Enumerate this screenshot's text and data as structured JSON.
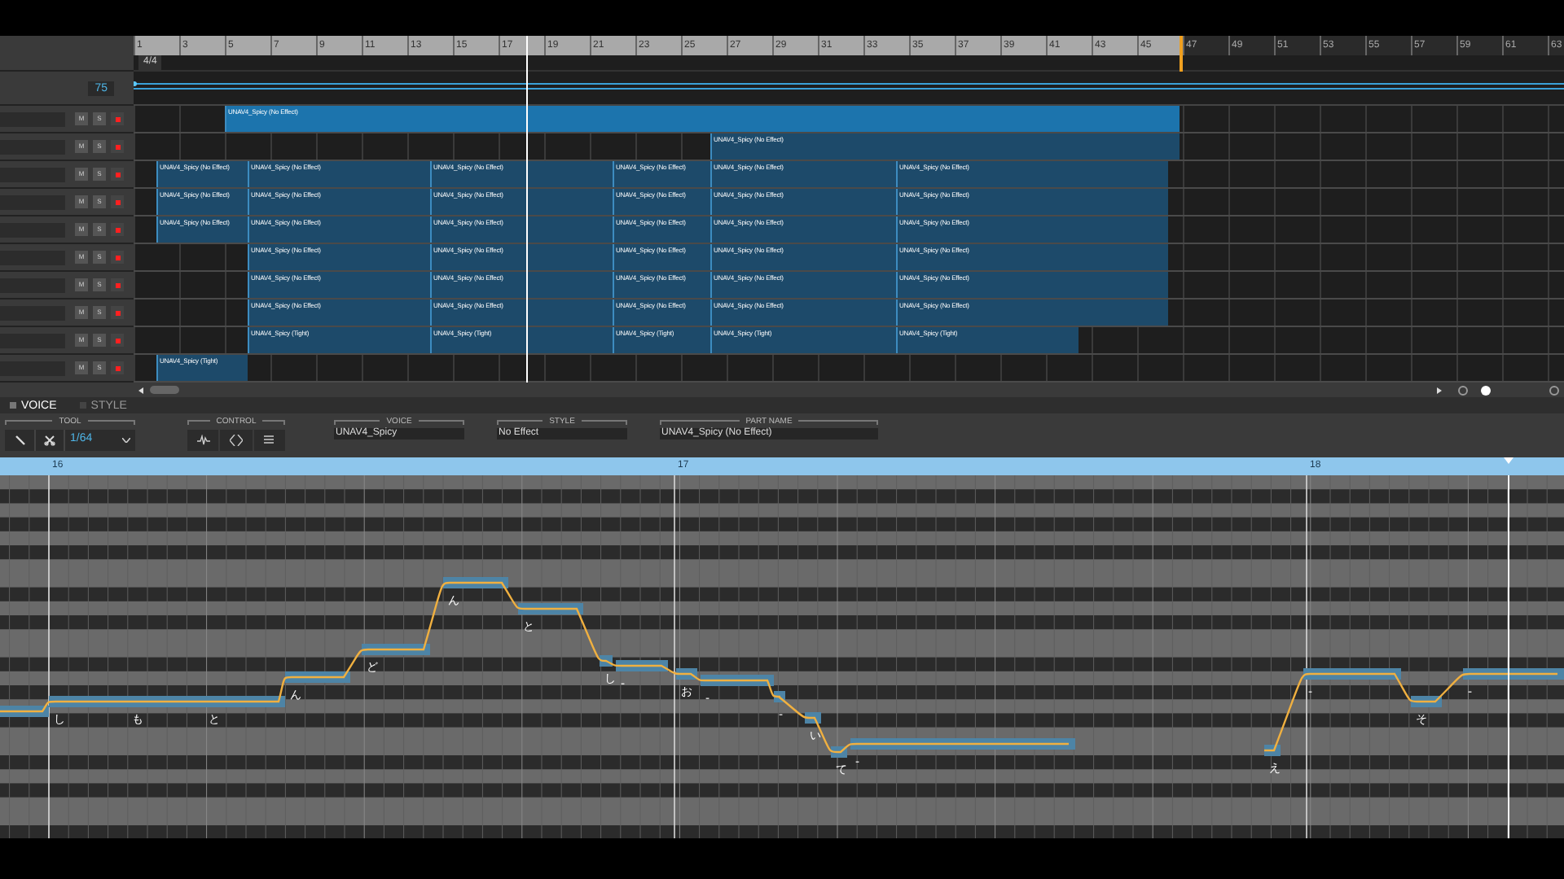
{
  "ruler": {
    "bars": [
      "1",
      "3",
      "5",
      "7",
      "9",
      "11",
      "13",
      "15",
      "17",
      "19",
      "21",
      "23",
      "25",
      "27",
      "29",
      "31",
      "33",
      "35",
      "37",
      "39",
      "41",
      "43",
      "45",
      "47",
      "49",
      "51",
      "53",
      "55",
      "57",
      "59",
      "61",
      "63"
    ]
  },
  "time_signature": "4/4",
  "tempo": "75",
  "tracks": [
    {
      "mute": "M",
      "solo": "S",
      "parts": [
        "UNAV4_Spicy (No Effect)"
      ]
    },
    {
      "mute": "M",
      "solo": "S",
      "parts": [
        "UNAV4_Spicy (No Effect)"
      ]
    },
    {
      "mute": "M",
      "solo": "S",
      "parts": [
        "UNAV4_Spicy (No Effect)",
        "UNAV4_Spicy (No Effect)",
        "UNAV4_Spicy (No Effect)",
        "UNAV4_Spicy (No Effect)",
        "UNAV4_Spicy (No Effect)",
        "UNAV4_Spicy (No Effect)"
      ]
    },
    {
      "mute": "M",
      "solo": "S",
      "parts": [
        "UNAV4_Spicy (No Effect)",
        "UNAV4_Spicy (No Effect)",
        "UNAV4_Spicy (No Effect)",
        "UNAV4_Spicy (No Effect)",
        "UNAV4_Spicy (No Effect)",
        "UNAV4_Spicy (No Effect)"
      ]
    },
    {
      "mute": "M",
      "solo": "S",
      "parts": [
        "UNAV4_Spicy (No Effect)",
        "UNAV4_Spicy (No Effect)",
        "UNAV4_Spicy (No Effect)",
        "UNAV4_Spicy (No Effect)",
        "UNAV4_Spicy (No Effect)",
        "UNAV4_Spicy (No Effect)"
      ]
    },
    {
      "mute": "M",
      "solo": "S",
      "parts": [
        "UNAV4_Spicy (No Effect)",
        "UNAV4_Spicy (No Effect)",
        "UNAV4_Spicy (No Effect)",
        "UNAV4_Spicy (No Effect)",
        "UNAV4_Spicy (No Effect)"
      ]
    },
    {
      "mute": "M",
      "solo": "S",
      "parts": [
        "UNAV4_Spicy (No Effect)",
        "UNAV4_Spicy (No Effect)",
        "UNAV4_Spicy (No Effect)",
        "UNAV4_Spicy (No Effect)",
        "UNAV4_Spicy (No Effect)"
      ]
    },
    {
      "mute": "M",
      "solo": "S",
      "parts": [
        "UNAV4_Spicy (No Effect)",
        "UNAV4_Spicy (No Effect)",
        "UNAV4_Spicy (No Effect)",
        "UNAV4_Spicy (No Effect)",
        "UNAV4_Spicy (No Effect)"
      ]
    },
    {
      "mute": "M",
      "solo": "S",
      "parts": [
        "UNAV4_Spicy (Tight)",
        "UNAV4_Spicy (Tight)",
        "UNAV4_Spicy (Tight)",
        "UNAV4_Spicy (Tight)",
        "UNAV4_Spicy (Tight)"
      ]
    },
    {
      "mute": "M",
      "solo": "S",
      "parts": [
        "UNAV4_Spicy (Tight)"
      ]
    }
  ],
  "panel_tabs": [
    {
      "label": "VOICE",
      "selected": true
    },
    {
      "label": "STYLE",
      "selected": false
    }
  ],
  "tool": {
    "label": "TOOL",
    "quantize": "1/64"
  },
  "control": {
    "label": "CONTROL"
  },
  "voice": {
    "label": "VOICE",
    "value": "UNAV4_Spicy"
  },
  "style": {
    "label": "STYLE",
    "value": "No Effect"
  },
  "part_name": {
    "label": "PART NAME",
    "value": "UNAV4_Spicy (No Effect)"
  },
  "piano_roll": {
    "bars": [
      "16",
      "17",
      "18"
    ],
    "lyrics": [
      "し",
      "も",
      "と",
      "ん",
      "ど",
      "ん",
      "と",
      "し",
      "-",
      "お",
      "-",
      "-",
      "い",
      "て",
      "-",
      "え",
      "-",
      "そ",
      "-"
    ]
  }
}
